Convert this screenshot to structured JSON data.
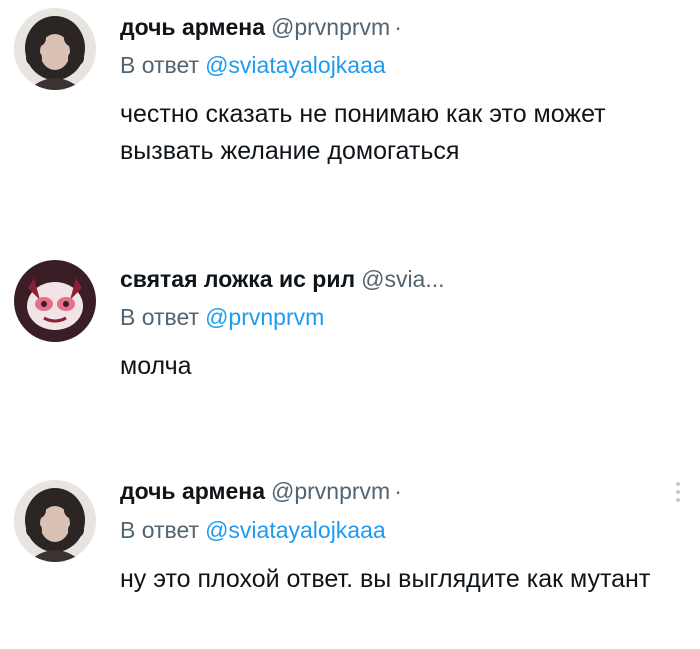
{
  "tweets": [
    {
      "author_name": "дочь армена",
      "handle": "@prvnprvm",
      "separator": "·",
      "reply_prefix": "В ответ",
      "reply_to": "@sviatayalojkaaa",
      "text": "честно сказать не понимаю как это может вызвать желание домогаться",
      "avatar_icon": "profile-photo-woman-curly-hair"
    },
    {
      "author_name": "святая ложка ис рил",
      "handle": "@svia...",
      "separator": "",
      "reply_prefix": "В ответ",
      "reply_to": "@prvnprvm",
      "text": "молча",
      "avatar_icon": "profile-cartoon-demon-face"
    },
    {
      "author_name": "дочь армена",
      "handle": "@prvnprvm",
      "separator": "·",
      "reply_prefix": "В ответ",
      "reply_to": "@sviatayalojkaaa",
      "text": "ну это плохой ответ. вы выглядите как мутант",
      "avatar_icon": "profile-photo-woman-curly-hair",
      "more_icon": "more-vertical-icon"
    }
  ],
  "colors": {
    "text": "#0f1419",
    "secondary": "#536471",
    "link": "#1d9bf0"
  }
}
